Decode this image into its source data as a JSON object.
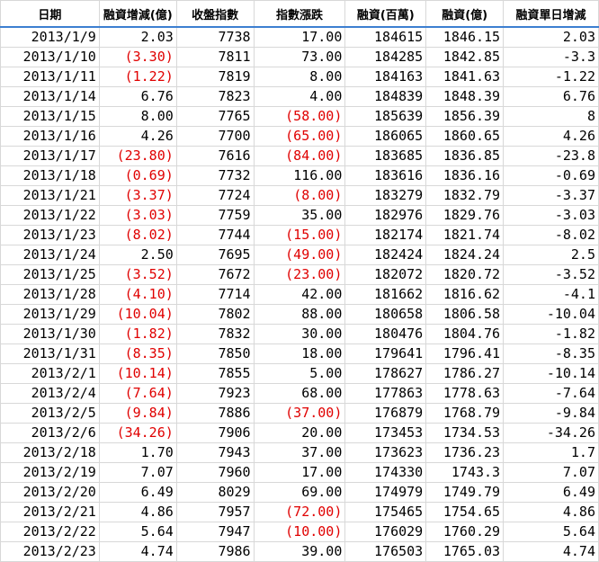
{
  "colors": {
    "negative": "#e00000",
    "header_rule": "#3c7fd0",
    "grid": "#d8d8d8"
  },
  "headers": [
    "日期",
    "融資增減(億)",
    "收盤指數",
    "指數漲跌",
    "融資(百萬)",
    "融資(億)",
    "融資單日增減"
  ],
  "rows": [
    [
      "2013/1/9",
      "2.03",
      "7738",
      "17.00",
      "184615",
      "1846.15",
      "2.03"
    ],
    [
      "2013/1/10",
      "(3.30)",
      "7811",
      "73.00",
      "184285",
      "1842.85",
      "-3.3"
    ],
    [
      "2013/1/11",
      "(1.22)",
      "7819",
      "8.00",
      "184163",
      "1841.63",
      "-1.22"
    ],
    [
      "2013/1/14",
      "6.76",
      "7823",
      "4.00",
      "184839",
      "1848.39",
      "6.76"
    ],
    [
      "2013/1/15",
      "8.00",
      "7765",
      "(58.00)",
      "185639",
      "1856.39",
      "8"
    ],
    [
      "2013/1/16",
      "4.26",
      "7700",
      "(65.00)",
      "186065",
      "1860.65",
      "4.26"
    ],
    [
      "2013/1/17",
      "(23.80)",
      "7616",
      "(84.00)",
      "183685",
      "1836.85",
      "-23.8"
    ],
    [
      "2013/1/18",
      "(0.69)",
      "7732",
      "116.00",
      "183616",
      "1836.16",
      "-0.69"
    ],
    [
      "2013/1/21",
      "(3.37)",
      "7724",
      "(8.00)",
      "183279",
      "1832.79",
      "-3.37"
    ],
    [
      "2013/1/22",
      "(3.03)",
      "7759",
      "35.00",
      "182976",
      "1829.76",
      "-3.03"
    ],
    [
      "2013/1/23",
      "(8.02)",
      "7744",
      "(15.00)",
      "182174",
      "1821.74",
      "-8.02"
    ],
    [
      "2013/1/24",
      "2.50",
      "7695",
      "(49.00)",
      "182424",
      "1824.24",
      "2.5"
    ],
    [
      "2013/1/25",
      "(3.52)",
      "7672",
      "(23.00)",
      "182072",
      "1820.72",
      "-3.52"
    ],
    [
      "2013/1/28",
      "(4.10)",
      "7714",
      "42.00",
      "181662",
      "1816.62",
      "-4.1"
    ],
    [
      "2013/1/29",
      "(10.04)",
      "7802",
      "88.00",
      "180658",
      "1806.58",
      "-10.04"
    ],
    [
      "2013/1/30",
      "(1.82)",
      "7832",
      "30.00",
      "180476",
      "1804.76",
      "-1.82"
    ],
    [
      "2013/1/31",
      "(8.35)",
      "7850",
      "18.00",
      "179641",
      "1796.41",
      "-8.35"
    ],
    [
      "2013/2/1",
      "(10.14)",
      "7855",
      "5.00",
      "178627",
      "1786.27",
      "-10.14"
    ],
    [
      "2013/2/4",
      "(7.64)",
      "7923",
      "68.00",
      "177863",
      "1778.63",
      "-7.64"
    ],
    [
      "2013/2/5",
      "(9.84)",
      "7886",
      "(37.00)",
      "176879",
      "1768.79",
      "-9.84"
    ],
    [
      "2013/2/6",
      "(34.26)",
      "7906",
      "20.00",
      "173453",
      "1734.53",
      "-34.26"
    ],
    [
      "2013/2/18",
      "1.70",
      "7943",
      "37.00",
      "173623",
      "1736.23",
      "1.7"
    ],
    [
      "2013/2/19",
      "7.07",
      "7960",
      "17.00",
      "174330",
      "1743.3",
      "7.07"
    ],
    [
      "2013/2/20",
      "6.49",
      "8029",
      "69.00",
      "174979",
      "1749.79",
      "6.49"
    ],
    [
      "2013/2/21",
      "4.86",
      "7957",
      "(72.00)",
      "175465",
      "1754.65",
      "4.86"
    ],
    [
      "2013/2/22",
      "5.64",
      "7947",
      "(10.00)",
      "176029",
      "1760.29",
      "5.64"
    ],
    [
      "2013/2/23",
      "4.74",
      "7986",
      "39.00",
      "176503",
      "1765.03",
      "4.74"
    ]
  ]
}
